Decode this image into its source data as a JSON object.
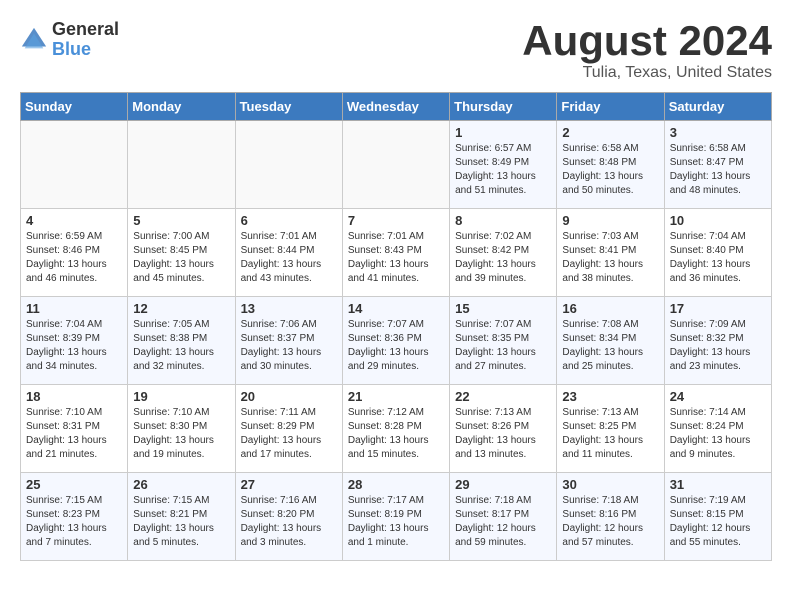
{
  "logo": {
    "general": "General",
    "blue": "Blue"
  },
  "title": {
    "month_year": "August 2024",
    "location": "Tulia, Texas, United States"
  },
  "headers": [
    "Sunday",
    "Monday",
    "Tuesday",
    "Wednesday",
    "Thursday",
    "Friday",
    "Saturday"
  ],
  "weeks": [
    [
      {
        "day": "",
        "info": ""
      },
      {
        "day": "",
        "info": ""
      },
      {
        "day": "",
        "info": ""
      },
      {
        "day": "",
        "info": ""
      },
      {
        "day": "1",
        "info": "Sunrise: 6:57 AM\nSunset: 8:49 PM\nDaylight: 13 hours\nand 51 minutes."
      },
      {
        "day": "2",
        "info": "Sunrise: 6:58 AM\nSunset: 8:48 PM\nDaylight: 13 hours\nand 50 minutes."
      },
      {
        "day": "3",
        "info": "Sunrise: 6:58 AM\nSunset: 8:47 PM\nDaylight: 13 hours\nand 48 minutes."
      }
    ],
    [
      {
        "day": "4",
        "info": "Sunrise: 6:59 AM\nSunset: 8:46 PM\nDaylight: 13 hours\nand 46 minutes."
      },
      {
        "day": "5",
        "info": "Sunrise: 7:00 AM\nSunset: 8:45 PM\nDaylight: 13 hours\nand 45 minutes."
      },
      {
        "day": "6",
        "info": "Sunrise: 7:01 AM\nSunset: 8:44 PM\nDaylight: 13 hours\nand 43 minutes."
      },
      {
        "day": "7",
        "info": "Sunrise: 7:01 AM\nSunset: 8:43 PM\nDaylight: 13 hours\nand 41 minutes."
      },
      {
        "day": "8",
        "info": "Sunrise: 7:02 AM\nSunset: 8:42 PM\nDaylight: 13 hours\nand 39 minutes."
      },
      {
        "day": "9",
        "info": "Sunrise: 7:03 AM\nSunset: 8:41 PM\nDaylight: 13 hours\nand 38 minutes."
      },
      {
        "day": "10",
        "info": "Sunrise: 7:04 AM\nSunset: 8:40 PM\nDaylight: 13 hours\nand 36 minutes."
      }
    ],
    [
      {
        "day": "11",
        "info": "Sunrise: 7:04 AM\nSunset: 8:39 PM\nDaylight: 13 hours\nand 34 minutes."
      },
      {
        "day": "12",
        "info": "Sunrise: 7:05 AM\nSunset: 8:38 PM\nDaylight: 13 hours\nand 32 minutes."
      },
      {
        "day": "13",
        "info": "Sunrise: 7:06 AM\nSunset: 8:37 PM\nDaylight: 13 hours\nand 30 minutes."
      },
      {
        "day": "14",
        "info": "Sunrise: 7:07 AM\nSunset: 8:36 PM\nDaylight: 13 hours\nand 29 minutes."
      },
      {
        "day": "15",
        "info": "Sunrise: 7:07 AM\nSunset: 8:35 PM\nDaylight: 13 hours\nand 27 minutes."
      },
      {
        "day": "16",
        "info": "Sunrise: 7:08 AM\nSunset: 8:34 PM\nDaylight: 13 hours\nand 25 minutes."
      },
      {
        "day": "17",
        "info": "Sunrise: 7:09 AM\nSunset: 8:32 PM\nDaylight: 13 hours\nand 23 minutes."
      }
    ],
    [
      {
        "day": "18",
        "info": "Sunrise: 7:10 AM\nSunset: 8:31 PM\nDaylight: 13 hours\nand 21 minutes."
      },
      {
        "day": "19",
        "info": "Sunrise: 7:10 AM\nSunset: 8:30 PM\nDaylight: 13 hours\nand 19 minutes."
      },
      {
        "day": "20",
        "info": "Sunrise: 7:11 AM\nSunset: 8:29 PM\nDaylight: 13 hours\nand 17 minutes."
      },
      {
        "day": "21",
        "info": "Sunrise: 7:12 AM\nSunset: 8:28 PM\nDaylight: 13 hours\nand 15 minutes."
      },
      {
        "day": "22",
        "info": "Sunrise: 7:13 AM\nSunset: 8:26 PM\nDaylight: 13 hours\nand 13 minutes."
      },
      {
        "day": "23",
        "info": "Sunrise: 7:13 AM\nSunset: 8:25 PM\nDaylight: 13 hours\nand 11 minutes."
      },
      {
        "day": "24",
        "info": "Sunrise: 7:14 AM\nSunset: 8:24 PM\nDaylight: 13 hours\nand 9 minutes."
      }
    ],
    [
      {
        "day": "25",
        "info": "Sunrise: 7:15 AM\nSunset: 8:23 PM\nDaylight: 13 hours\nand 7 minutes."
      },
      {
        "day": "26",
        "info": "Sunrise: 7:15 AM\nSunset: 8:21 PM\nDaylight: 13 hours\nand 5 minutes."
      },
      {
        "day": "27",
        "info": "Sunrise: 7:16 AM\nSunset: 8:20 PM\nDaylight: 13 hours\nand 3 minutes."
      },
      {
        "day": "28",
        "info": "Sunrise: 7:17 AM\nSunset: 8:19 PM\nDaylight: 13 hours\nand 1 minute."
      },
      {
        "day": "29",
        "info": "Sunrise: 7:18 AM\nSunset: 8:17 PM\nDaylight: 12 hours\nand 59 minutes."
      },
      {
        "day": "30",
        "info": "Sunrise: 7:18 AM\nSunset: 8:16 PM\nDaylight: 12 hours\nand 57 minutes."
      },
      {
        "day": "31",
        "info": "Sunrise: 7:19 AM\nSunset: 8:15 PM\nDaylight: 12 hours\nand 55 minutes."
      }
    ]
  ]
}
